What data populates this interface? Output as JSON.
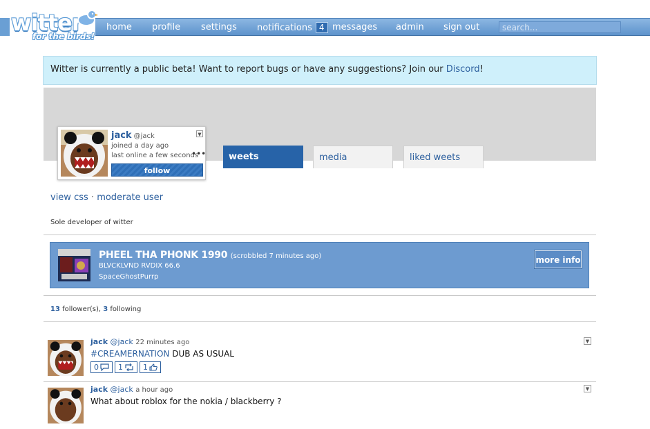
{
  "header": {
    "logo_text": "witter",
    "logo_tagline": "for the birds!",
    "nav": {
      "home": "home",
      "profile": "profile",
      "settings": "settings",
      "notifications": "notifications",
      "notifications_count": "4",
      "messages": "messages",
      "admin": "admin",
      "signout": "sign out"
    },
    "search_placeholder": "search..."
  },
  "notice": {
    "text": "Witter is currently a public beta! Want to report bugs or have any suggestions? Join our ",
    "link": "Discord",
    "end": "!"
  },
  "profile": {
    "name": "jack",
    "handle": "@jack",
    "joined": "joined a day ago",
    "last_online": "last online a few seconds",
    "more": "•••",
    "follow_label": "follow",
    "tabs": [
      "weets",
      "media",
      "liked weets"
    ],
    "links": {
      "view_css": "view css",
      "sep": "·",
      "moderate": "moderate user"
    },
    "bio": "Sole developer of witter",
    "followers_count": "13",
    "followers_label": "follower(s),",
    "following_count": "3",
    "following_label": "following"
  },
  "scrobble": {
    "track": "PHEEL THA PHONK 1990",
    "time": "(scrobbled 7 minutes ago)",
    "album": "BLVCKLVND RVDIX 66.6",
    "artist": "SpaceGhostPurrp",
    "more_info": "more info"
  },
  "weets": [
    {
      "name": "jack",
      "handle": "@jack",
      "time": "22 minutes ago",
      "hashtag": "#CREAMERNATION",
      "text": " DUB AS USUAL",
      "replies": "0",
      "reweets": "1",
      "likes": "1"
    },
    {
      "name": "jack",
      "handle": "@jack",
      "time": "a hour ago",
      "text": "What about roblox for the nokia / blackberry ?"
    }
  ],
  "colors": {
    "accent": "#2c5f9e",
    "nav_bg": "#6a9fd4",
    "tab_active": "#2763a8",
    "scrobble_bg": "#6d9bd0",
    "notice_bg": "#cff0fb"
  },
  "icons": [
    "twitter-bird-icon",
    "comment-icon",
    "reweet-icon",
    "thumbs-up-icon",
    "chevron-down-icon"
  ]
}
